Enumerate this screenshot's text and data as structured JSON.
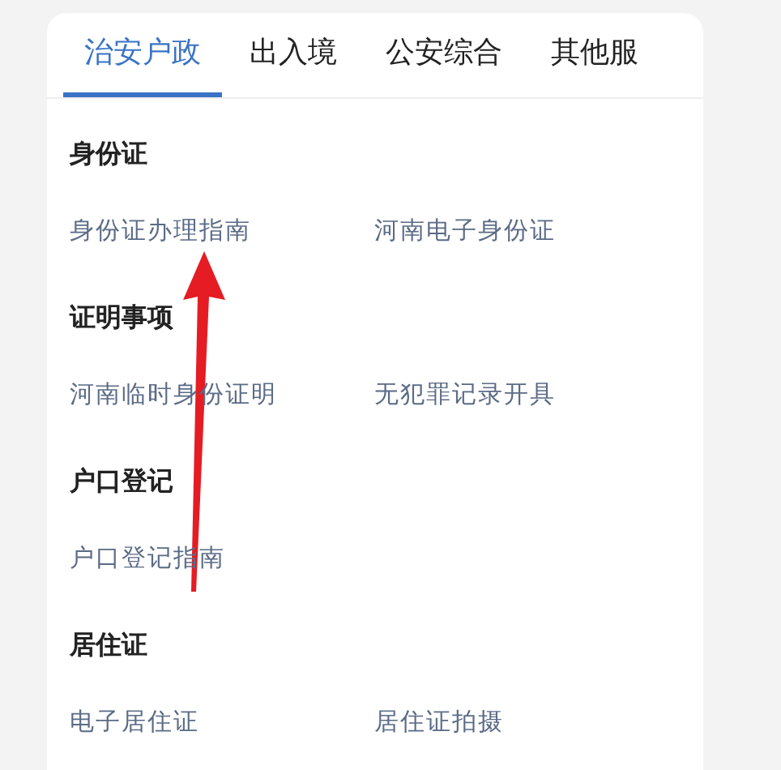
{
  "tabs": [
    {
      "label": "治安户政",
      "selected": true
    },
    {
      "label": "出入境",
      "selected": false
    },
    {
      "label": "公安综合",
      "selected": false
    },
    {
      "label": "其他服",
      "selected": false
    }
  ],
  "sections": [
    {
      "title": "身份证",
      "items": [
        "身份证办理指南",
        "河南电子身份证"
      ]
    },
    {
      "title": "证明事项",
      "items": [
        "河南临时身份证明",
        "无犯罪记录开具"
      ]
    },
    {
      "title": "户口登记",
      "items": [
        "户口登记指南"
      ]
    },
    {
      "title": "居住证",
      "items": [
        "电子居住证",
        "居住证拍摄"
      ]
    }
  ]
}
